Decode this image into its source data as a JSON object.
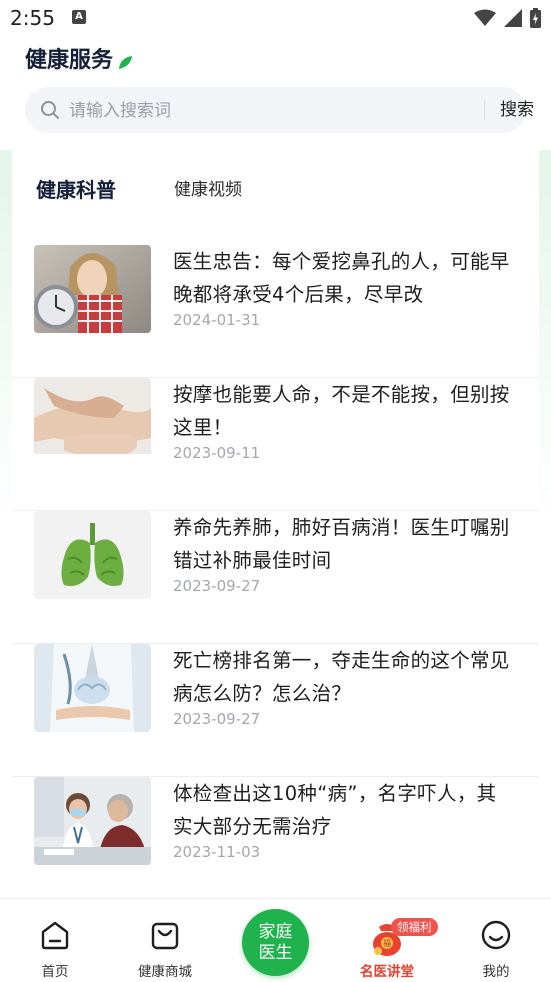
{
  "status_bar": {
    "time": "2:55"
  },
  "header": {
    "title": "健康服务"
  },
  "search": {
    "placeholder": "请输入搜索词",
    "button_label": "搜索"
  },
  "tabs": [
    {
      "label": "健康科普",
      "active": true
    },
    {
      "label": "健康视频",
      "active": false
    }
  ],
  "articles": [
    {
      "title": "医生忠告：每个爱挖鼻孔的人，可能早晚都将承受4个后果，尽早改",
      "date": "2024-01-31",
      "thumbnail": "woman-with-clock"
    },
    {
      "title": "按摩也能要人命，不是不能按，但别按这里！",
      "date": "2023-09-11",
      "thumbnail": "foot-massage"
    },
    {
      "title": "养命先养肺，肺好百病消！医生叮嘱别错过补肺最佳时间",
      "date": "2023-09-27",
      "thumbnail": "green-lungs"
    },
    {
      "title": "死亡榜排名第一，夺走生命的这个常见病怎么防？怎么治？",
      "date": "2023-09-27",
      "thumbnail": "doctor-holding-brain"
    },
    {
      "title": "体检查出这10种“病”，名字吓人，其实大部分无需治疗",
      "date": "2023-11-03",
      "thumbnail": "doctor-with-patient"
    }
  ],
  "bottom_nav": {
    "home": "首页",
    "mall": "健康商城",
    "family_doctor_line1": "家庭",
    "family_doctor_line2": "医生",
    "lecture": "名医讲堂",
    "lecture_badge": "领福利",
    "mine": "我的"
  },
  "colors": {
    "accent_green": "#20b24c",
    "lecture_red": "#e9422f",
    "badge_red": "#f1524d"
  }
}
